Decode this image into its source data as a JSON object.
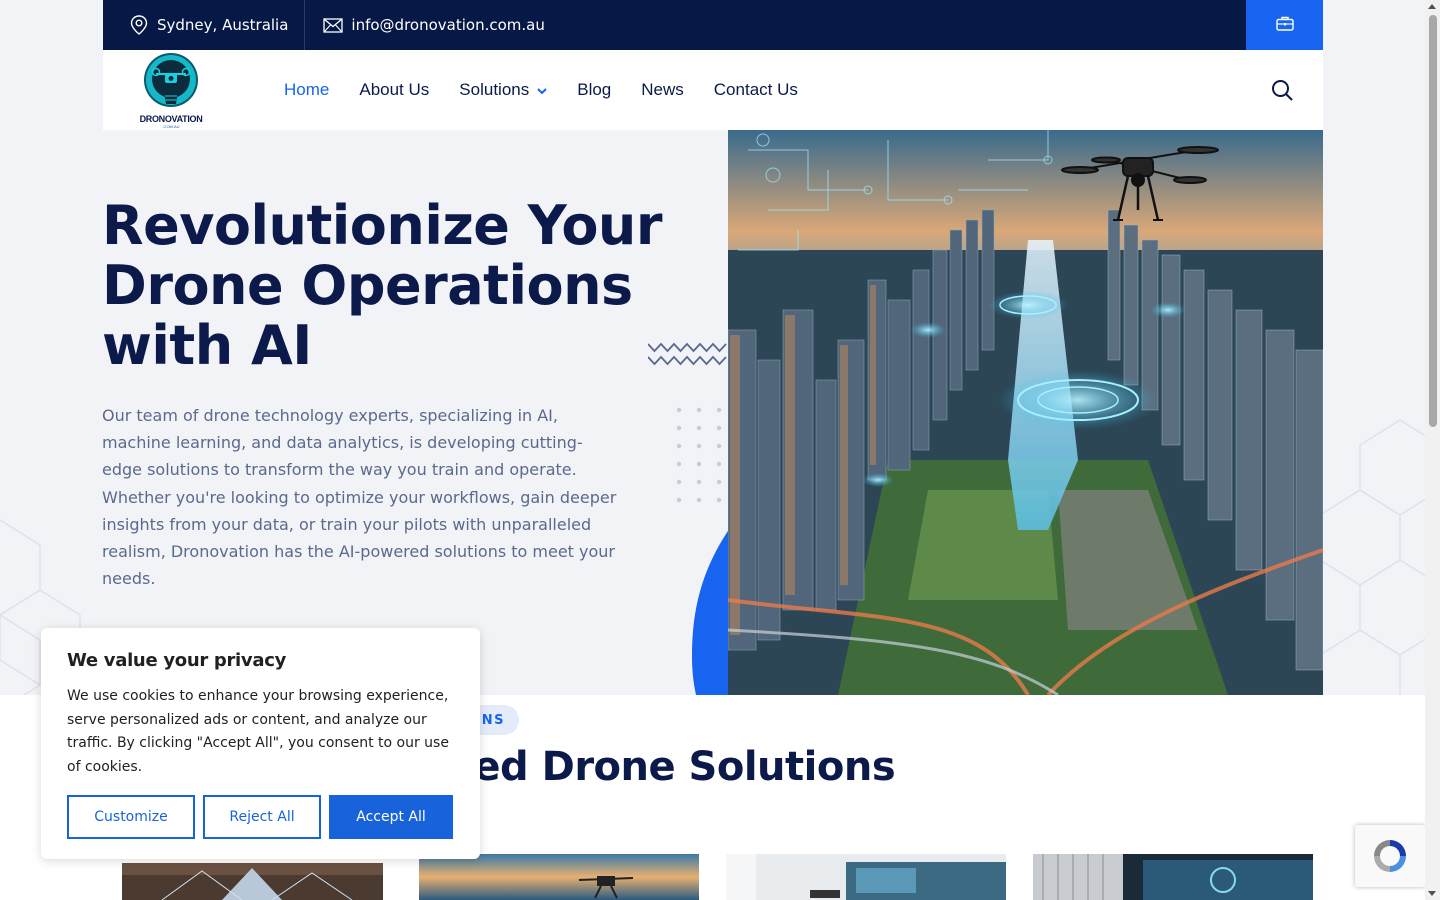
{
  "topbar": {
    "location": "Sydney, Australia",
    "email": "info@dronovation.com.au",
    "icons": [
      "map-pin-icon",
      "envelope-icon",
      "briefcase-icon"
    ]
  },
  "logo": {
    "name": "DRONOVATION",
    "sub": ".COM.AU"
  },
  "nav": {
    "items": [
      {
        "label": "Home"
      },
      {
        "label": "About Us"
      },
      {
        "label": "Solutions"
      },
      {
        "label": "Blog"
      },
      {
        "label": "News"
      },
      {
        "label": "Contact Us"
      }
    ],
    "active": "Home"
  },
  "hero": {
    "title": "Revolutionize Your Drone Operations with AI",
    "text": "Our team of drone technology experts, specializing in AI, machine learning, and data analytics, is developing cutting-edge solutions to transform the way you train and operate. Whether you're looking to optimize your workflows, gain deeper insights from your data, or train your pilots with unparalleled realism, Dronovation has the AI-powered solutions to meet your needs."
  },
  "solutions": {
    "badge": "ONS",
    "title": "vered Drone Solutions"
  },
  "cookie": {
    "title": "We value your privacy",
    "text": "We use cookies to enhance your browsing experience, serve personalized ads or content, and analyze our traffic. By clicking \"Accept All\", you consent to our use of cookies.",
    "customize": "Customize",
    "reject": "Reject All",
    "accept": "Accept All"
  },
  "colors": {
    "navy": "#061846",
    "brand_blue": "#1664f0",
    "heading": "#0b1a4a",
    "body_text": "#5a6a8c"
  }
}
